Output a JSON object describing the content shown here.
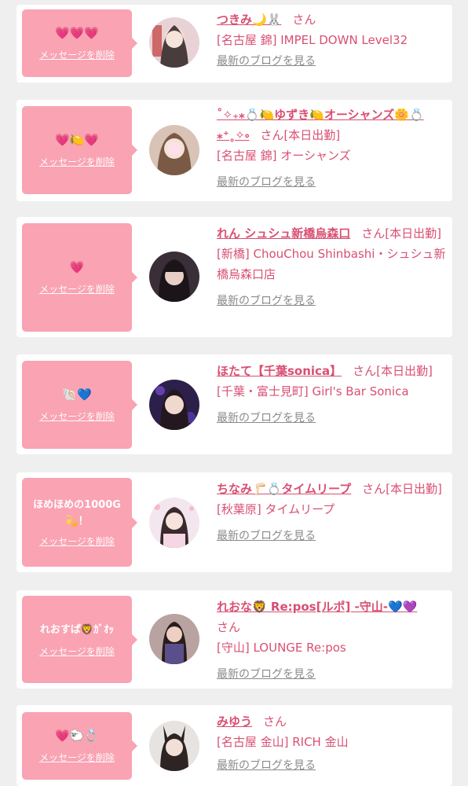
{
  "common": {
    "delete_label": "メッセージを削除",
    "blog_label": "最新のブログを見る",
    "honorific": "さん"
  },
  "colors": {
    "page_background": "#efefef",
    "card_background": "#ffffff",
    "bubble_background": "#f9a3b3",
    "accent_text": "#d94f72",
    "muted_link": "#8a8a8a"
  },
  "items": [
    {
      "message": "💗💗💗",
      "name": "つきみ🌙🐰",
      "status": "",
      "shop": "[名古屋 錦] IMPEL DOWN Level32",
      "avatar_icon": "avatar-photo"
    },
    {
      "message": "💗🍋💗",
      "name": "˚✧₊⁎💍🍋ゆずき🍋オーシャンズ🌼💍⁎⁺˳✧༚",
      "status": "[本日出勤]",
      "shop": "[名古屋 錦] オーシャンズ",
      "avatar_icon": "avatar-photo"
    },
    {
      "message": "💗",
      "name": "れん シュシュ新橋烏森口",
      "status": "[本日出勤]",
      "shop": "[新橋] ChouChou Shinbashi・シュシュ新橋烏森口店",
      "avatar_icon": "avatar-photo"
    },
    {
      "message": "🐚💙",
      "name": "ほたて【千葉sonica】",
      "status": "[本日出勤]",
      "shop": "[千葉・富士見町] Girl's Bar Sonica",
      "avatar_icon": "avatar-photo"
    },
    {
      "message": "ほめほめの1000G💫！",
      "name": "ちなみ🦵🏻💍タイムリープ",
      "status": "[本日出勤]",
      "shop": "[秋葉原] タイムリープ",
      "avatar_icon": "avatar-photo"
    },
    {
      "message": "れおすぱ🦁ｶﾞｵｯ",
      "name": "れおな🦁 Re:pos[ルポ] -守山-💙💜",
      "status": "",
      "shop": "[守山] LOUNGE Re:pos",
      "avatar_icon": "avatar-photo"
    },
    {
      "message": "💗🐑💍",
      "name": "みゆう",
      "status": "",
      "shop": "[名古屋 金山] RICH 金山",
      "avatar_icon": "avatar-photo"
    }
  ]
}
